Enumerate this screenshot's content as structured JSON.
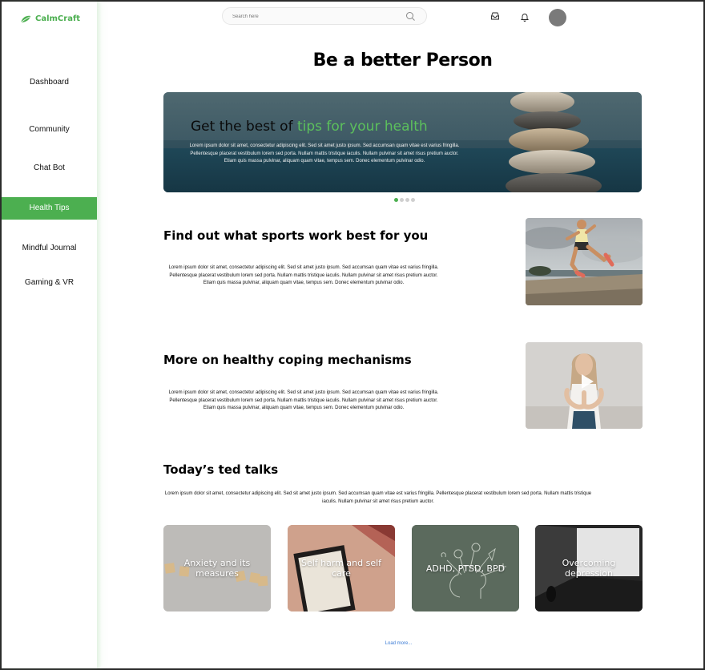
{
  "brand": {
    "name": "CalmCraft",
    "accent": "#4caf50"
  },
  "sidebar": {
    "items": [
      {
        "label": "Dashboard",
        "active": false
      },
      {
        "label": "Community",
        "active": false
      },
      {
        "label": "Chat Bot",
        "active": false
      },
      {
        "label": "Health Tips",
        "active": true
      },
      {
        "label": "Mindful Journal",
        "active": false
      },
      {
        "label": "Gaming & VR",
        "active": false
      }
    ]
  },
  "header": {
    "search_placeholder": "Search here",
    "icons": [
      "search-icon",
      "inbox-icon",
      "bell-icon",
      "avatar"
    ]
  },
  "page": {
    "title": "Be a better Person"
  },
  "hero": {
    "heading_plain": "Get the best of ",
    "heading_accent": "tips for your health",
    "text": "Lorem ipsum dolor sit amet, consectetur adipiscing elit. Sed sit amet justo ipsum. Sed accumsan quam vitae est varius fringilla. Pellentesque placerat vestibulum lorem sed porta. Nullam mattis tristique iaculis. Nullam pulvinar sit amet risus pretium auctor. Etiam quis massa pulvinar, aliquam quam vitae, tempus sem. Donec elementum pulvinar odio.",
    "carousel_total": 4,
    "carousel_active": 1
  },
  "sections": [
    {
      "title": "Find out what sports work best for you",
      "text": "Lorem ipsum dolor sit amet, consectetur adipiscing elit. Sed sit amet justo ipsum. Sed accumsan quam vitae est varius fringilla. Pellentesque placerat vestibulum lorem sed porta. Nullam mattis tristique iaculis. Nullam pulvinar sit amet risus pretium auctor. Etiam quis massa pulvinar, aliquam quam vitae, tempus sem. Donec elementum pulvinar odio."
    },
    {
      "title": "More on healthy coping mechanisms",
      "text": "Lorem ipsum dolor sit amet, consectetur adipiscing elit. Sed sit amet justo ipsum. Sed accumsan quam vitae est varius fringilla. Pellentesque placerat vestibulum lorem sed porta. Nullam mattis tristique iaculis. Nullam pulvinar sit amet risus pretium auctor. Etiam quis massa pulvinar, aliquam quam vitae, tempus sem. Donec elementum pulvinar odio."
    }
  ],
  "ted": {
    "title": "Today’s ted talks",
    "text": "Lorem ipsum dolor sit amet, consectetur adipiscing elit. Sed sit amet justo ipsum. Sed accumsan quam vitae est varius fringilla. Pellentesque placerat vestibulum lorem sed porta. Nullam mattis tristique iaculis. Nullam pulvinar sit amet risus pretium auctor.",
    "cards": [
      {
        "label": "Anxiety and its measures"
      },
      {
        "label": "Self harm and self care"
      },
      {
        "label": "ADHD, PTSD, BPD"
      },
      {
        "label": "Overcoming depression"
      }
    ],
    "load_more": "Load more..."
  }
}
